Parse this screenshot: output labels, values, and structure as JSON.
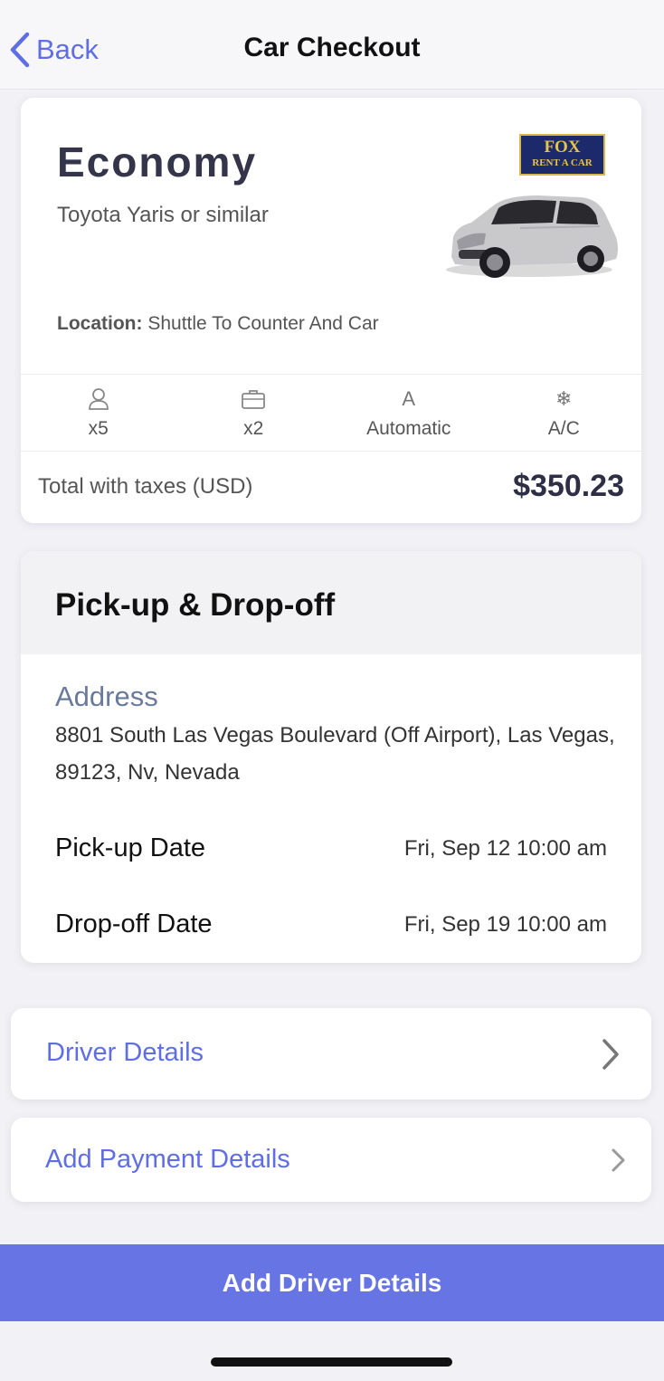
{
  "nav": {
    "back_label": "Back",
    "title": "Car Checkout"
  },
  "car": {
    "class": "Economy",
    "model": "Toyota Yaris or similar",
    "vendor_logo_line1": "FOX",
    "vendor_logo_line2": "RENT A CAR",
    "location_label": "Location:",
    "location_value": "Shuttle To Counter And Car",
    "features": [
      {
        "icon": "person-icon",
        "label": "x5"
      },
      {
        "icon": "luggage-icon",
        "label": "x2"
      },
      {
        "icon": "transmission-icon",
        "glyph": "A",
        "label": "Automatic"
      },
      {
        "icon": "snowflake-icon",
        "glyph": "❄",
        "label": "A/C"
      }
    ],
    "total_label": "Total with taxes (USD)",
    "total_price": "$350.23"
  },
  "pickup": {
    "title": "Pick-up & Drop-off",
    "address_label": "Address",
    "address_value": "8801 South Las Vegas Boulevard (Off Airport), Las Vegas, 89123, Nv, Nevada",
    "pickup_date_label": "Pick-up Date",
    "pickup_date_value": "Fri, Sep 12 10:00 am",
    "dropoff_date_label": "Drop-off Date",
    "dropoff_date_value": "Fri, Sep 19 10:00 am"
  },
  "links": {
    "driver_details": "Driver Details",
    "payment_details": "Add Payment Details"
  },
  "cta_label": "Add Driver Details",
  "colors": {
    "accent": "#5f6ee4",
    "cta_bg": "#6674e4",
    "background": "#f2f2f6"
  }
}
